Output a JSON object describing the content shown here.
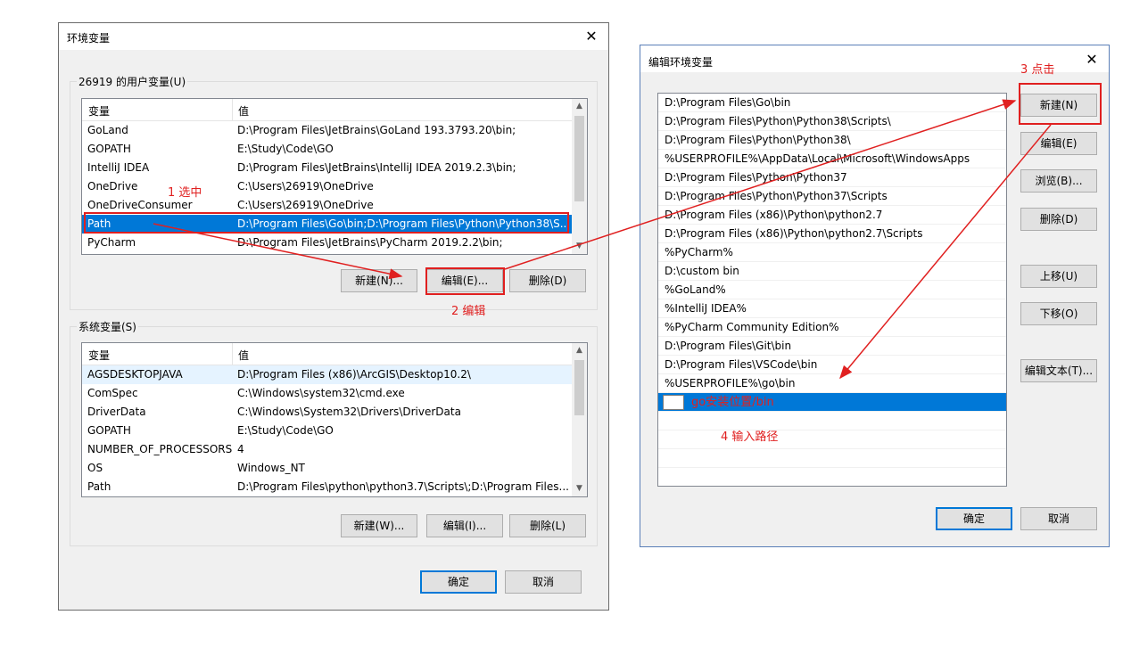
{
  "env_dialog": {
    "title": "环境变量",
    "close_glyph": "✕",
    "user_group_label": "26919 的用户变量(U)",
    "user_columns": [
      "变量",
      "值"
    ],
    "user_vars": [
      {
        "name": "GoLand",
        "value": "D:\\Program Files\\JetBrains\\GoLand 193.3793.20\\bin;"
      },
      {
        "name": "GOPATH",
        "value": "E:\\Study\\Code\\GO"
      },
      {
        "name": "IntelliJ IDEA",
        "value": "D:\\Program Files\\JetBrains\\IntelliJ IDEA 2019.2.3\\bin;"
      },
      {
        "name": "OneDrive",
        "value": "C:\\Users\\26919\\OneDrive"
      },
      {
        "name": "OneDriveConsumer",
        "value": "C:\\Users\\26919\\OneDrive"
      },
      {
        "name": "Path",
        "value": "D:\\Program Files\\Go\\bin;D:\\Program Files\\Python\\Python38\\S..."
      },
      {
        "name": "PyCharm",
        "value": "D:\\Program Files\\JetBrains\\PyCharm 2019.2.2\\bin;"
      }
    ],
    "user_buttons": {
      "new": "新建(N)...",
      "edit": "编辑(E)...",
      "delete": "删除(D)"
    },
    "system_group_label": "系统变量(S)",
    "system_columns": [
      "变量",
      "值"
    ],
    "system_vars": [
      {
        "name": "AGSDESKTOPJAVA",
        "value": "D:\\Program Files (x86)\\ArcGIS\\Desktop10.2\\"
      },
      {
        "name": "ComSpec",
        "value": "C:\\Windows\\system32\\cmd.exe"
      },
      {
        "name": "DriverData",
        "value": "C:\\Windows\\System32\\Drivers\\DriverData"
      },
      {
        "name": "GOPATH",
        "value": "E:\\Study\\Code\\GO"
      },
      {
        "name": "NUMBER_OF_PROCESSORS",
        "value": "4"
      },
      {
        "name": "OS",
        "value": "Windows_NT"
      },
      {
        "name": "Path",
        "value": "D:\\Program Files\\python\\python3.7\\Scripts\\;D:\\Program Files..."
      }
    ],
    "system_buttons": {
      "new": "新建(W)...",
      "edit": "编辑(I)...",
      "delete": "删除(L)"
    },
    "ok": "确定",
    "cancel": "取消"
  },
  "edit_dialog": {
    "title": "编辑环境变量",
    "close_glyph": "✕",
    "paths": [
      "D:\\Program Files\\Go\\bin",
      "D:\\Program Files\\Python\\Python38\\Scripts\\",
      "D:\\Program Files\\Python\\Python38\\",
      "%USERPROFILE%\\AppData\\Local\\Microsoft\\WindowsApps",
      "D:\\Program Files\\Python\\Python37",
      "D:\\Program Files\\Python\\Python37\\Scripts",
      "D:\\Program Files (x86)\\Python\\python2.7",
      "D:\\Program Files (x86)\\Python\\python2.7\\Scripts",
      "%PyCharm%",
      "D:\\custom bin",
      "%GoLand%",
      "%IntelliJ IDEA%",
      "%PyCharm Community Edition%",
      "D:\\Program Files\\Git\\bin",
      "D:\\Program Files\\VSCode\\bin",
      "%USERPROFILE%\\go\\bin"
    ],
    "editing_value": "go安装位置/bin",
    "buttons": {
      "new": "新建(N)",
      "edit": "编辑(E)",
      "browse": "浏览(B)...",
      "delete": "删除(D)",
      "move_up": "上移(U)",
      "move_down": "下移(O)",
      "edit_text": "编辑文本(T)..."
    },
    "ok": "确定",
    "cancel": "取消"
  },
  "annotations": {
    "step1": "1 选中",
    "step2": "2 编辑",
    "step3": "3 点击",
    "step4": "4 输入路径"
  },
  "colors": {
    "annotation": "#e02020",
    "selection": "#0078d7"
  }
}
